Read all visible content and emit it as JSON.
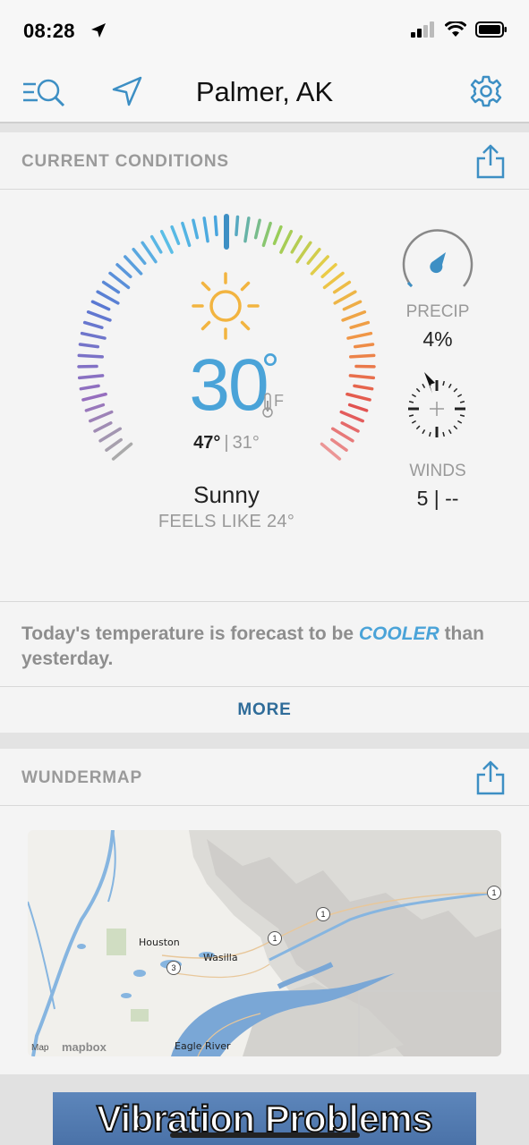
{
  "status_bar": {
    "time": "08:28"
  },
  "nav": {
    "location_title": "Palmer, AK"
  },
  "current_conditions": {
    "section_title": "CURRENT CONDITIONS",
    "temperature": "30",
    "degree_symbol": "°",
    "unit": "F",
    "high": "47°",
    "separator": "|",
    "low": "31°",
    "condition": "Sunny",
    "feels_like": "FEELS LIKE 24°",
    "condition_icon": "sun-icon",
    "precip_label": "PRECIP",
    "precip_value": "4%",
    "winds_label": "WINDS",
    "winds_value": "5 | --"
  },
  "forecast_note": {
    "text_before": "Today's temperature is forecast to be ",
    "emphasis": "COOLER",
    "text_after": " than yesterday.",
    "more_label": "MORE"
  },
  "wundermap": {
    "section_title": "WUNDERMAP",
    "labels": {
      "houston": "Houston",
      "wasilla": "Wasilla",
      "eagle_river": "Eagle River",
      "route_3": "3",
      "route_1a": "1",
      "route_1b": "1",
      "route_1c": "1"
    },
    "attribution": "Map",
    "provider": "mapbox"
  },
  "ad": {
    "text": "Vibration Problems"
  },
  "colors": {
    "accent_blue": "#4aa3d8",
    "link_blue": "#2f6c99",
    "muted_gray": "#9a9a9a"
  }
}
